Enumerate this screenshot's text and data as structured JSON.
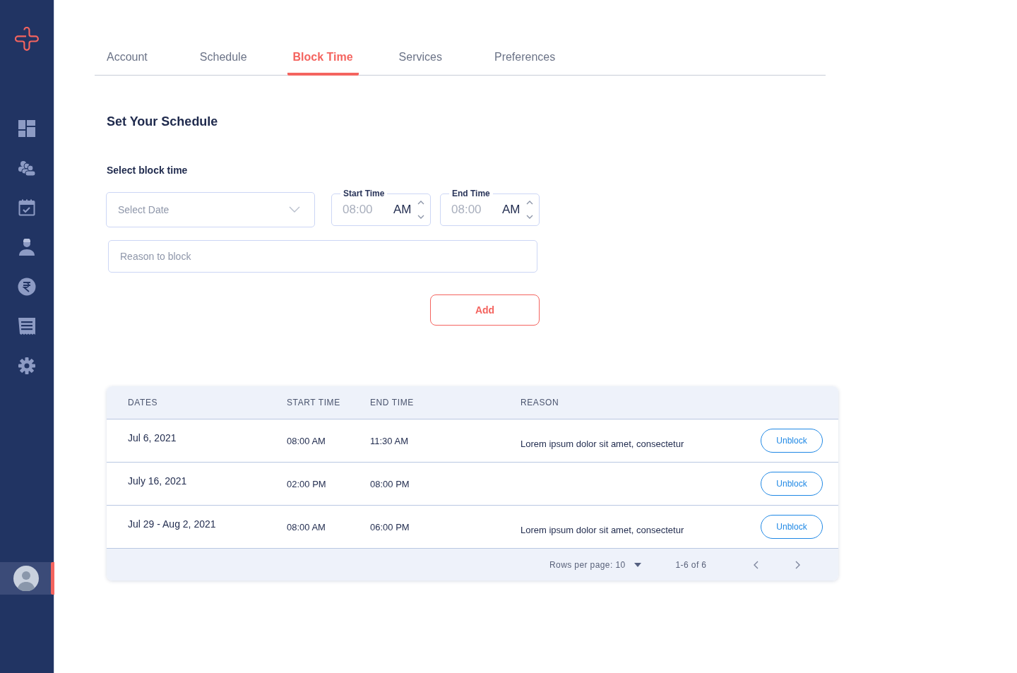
{
  "sidebar": {
    "items": [
      {
        "kind": "dashboard"
      },
      {
        "kind": "patients"
      },
      {
        "kind": "calendar"
      },
      {
        "kind": "doctor"
      },
      {
        "kind": "rupee"
      },
      {
        "kind": "receipt"
      },
      {
        "kind": "settings"
      }
    ],
    "profile": {
      "selected": true
    }
  },
  "tabs": [
    {
      "label": "Account",
      "selected": false
    },
    {
      "label": "Schedule",
      "selected": false
    },
    {
      "label": "Block Time",
      "selected": true
    },
    {
      "label": "Services",
      "selected": false
    },
    {
      "label": "Preferences",
      "selected": false
    }
  ],
  "heading": "Set Your Schedule",
  "form": {
    "title": "Select block time",
    "date": {
      "placeholder": "Select Date"
    },
    "start_time": {
      "label": "Start Time",
      "placeholder": "08:00",
      "period": "AM"
    },
    "end_time": {
      "label": "End Time",
      "placeholder": "08:00",
      "period": "AM"
    },
    "reason": {
      "placeholder": "Reason to block"
    },
    "add_button": "Add"
  },
  "table": {
    "columns": [
      "DATES",
      "START TIME",
      "END TIME",
      "REASON"
    ],
    "rows": [
      {
        "dates": "Jul 6, 2021",
        "start_time": "08:00 AM",
        "end_time": "11:30 AM",
        "reason": "Lorem ipsum dolor sit amet, consectetur",
        "action": "Unblock"
      },
      {
        "dates": "July 16, 2021",
        "start_time": "02:00 PM",
        "end_time": "08:00 PM",
        "action": "Unblock"
      },
      {
        "dates": "Jul 29 - Aug 2, 2021",
        "start_time": "08:00 AM",
        "end_time": "06:00 PM",
        "reason": "Lorem ipsum dolor sit amet, consectetur",
        "action": "Unblock"
      }
    ],
    "footer": {
      "rows_per_page": "Rows per page: 10",
      "range": "1-6 of 6"
    }
  }
}
